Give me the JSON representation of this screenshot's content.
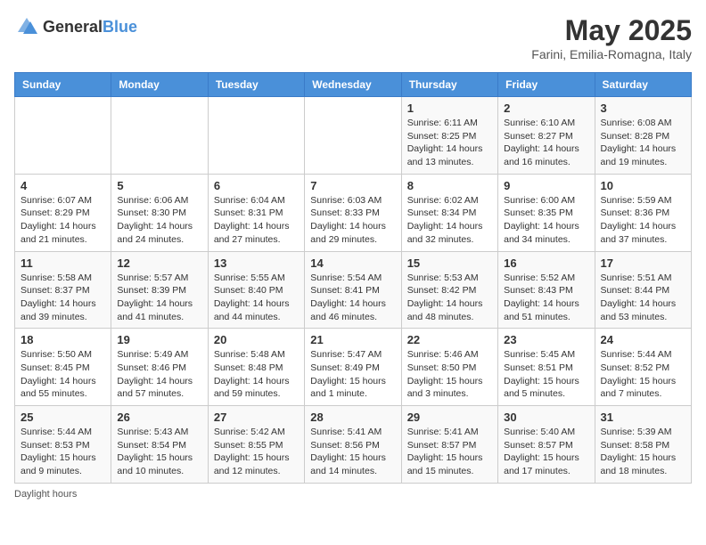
{
  "header": {
    "logo_general": "General",
    "logo_blue": "Blue",
    "month": "May 2025",
    "location": "Farini, Emilia-Romagna, Italy"
  },
  "weekdays": [
    "Sunday",
    "Monday",
    "Tuesday",
    "Wednesday",
    "Thursday",
    "Friday",
    "Saturday"
  ],
  "weeks": [
    [
      {
        "day": "",
        "info": ""
      },
      {
        "day": "",
        "info": ""
      },
      {
        "day": "",
        "info": ""
      },
      {
        "day": "",
        "info": ""
      },
      {
        "day": "1",
        "info": "Sunrise: 6:11 AM\nSunset: 8:25 PM\nDaylight: 14 hours and 13 minutes."
      },
      {
        "day": "2",
        "info": "Sunrise: 6:10 AM\nSunset: 8:27 PM\nDaylight: 14 hours and 16 minutes."
      },
      {
        "day": "3",
        "info": "Sunrise: 6:08 AM\nSunset: 8:28 PM\nDaylight: 14 hours and 19 minutes."
      }
    ],
    [
      {
        "day": "4",
        "info": "Sunrise: 6:07 AM\nSunset: 8:29 PM\nDaylight: 14 hours and 21 minutes."
      },
      {
        "day": "5",
        "info": "Sunrise: 6:06 AM\nSunset: 8:30 PM\nDaylight: 14 hours and 24 minutes."
      },
      {
        "day": "6",
        "info": "Sunrise: 6:04 AM\nSunset: 8:31 PM\nDaylight: 14 hours and 27 minutes."
      },
      {
        "day": "7",
        "info": "Sunrise: 6:03 AM\nSunset: 8:33 PM\nDaylight: 14 hours and 29 minutes."
      },
      {
        "day": "8",
        "info": "Sunrise: 6:02 AM\nSunset: 8:34 PM\nDaylight: 14 hours and 32 minutes."
      },
      {
        "day": "9",
        "info": "Sunrise: 6:00 AM\nSunset: 8:35 PM\nDaylight: 14 hours and 34 minutes."
      },
      {
        "day": "10",
        "info": "Sunrise: 5:59 AM\nSunset: 8:36 PM\nDaylight: 14 hours and 37 minutes."
      }
    ],
    [
      {
        "day": "11",
        "info": "Sunrise: 5:58 AM\nSunset: 8:37 PM\nDaylight: 14 hours and 39 minutes."
      },
      {
        "day": "12",
        "info": "Sunrise: 5:57 AM\nSunset: 8:39 PM\nDaylight: 14 hours and 41 minutes."
      },
      {
        "day": "13",
        "info": "Sunrise: 5:55 AM\nSunset: 8:40 PM\nDaylight: 14 hours and 44 minutes."
      },
      {
        "day": "14",
        "info": "Sunrise: 5:54 AM\nSunset: 8:41 PM\nDaylight: 14 hours and 46 minutes."
      },
      {
        "day": "15",
        "info": "Sunrise: 5:53 AM\nSunset: 8:42 PM\nDaylight: 14 hours and 48 minutes."
      },
      {
        "day": "16",
        "info": "Sunrise: 5:52 AM\nSunset: 8:43 PM\nDaylight: 14 hours and 51 minutes."
      },
      {
        "day": "17",
        "info": "Sunrise: 5:51 AM\nSunset: 8:44 PM\nDaylight: 14 hours and 53 minutes."
      }
    ],
    [
      {
        "day": "18",
        "info": "Sunrise: 5:50 AM\nSunset: 8:45 PM\nDaylight: 14 hours and 55 minutes."
      },
      {
        "day": "19",
        "info": "Sunrise: 5:49 AM\nSunset: 8:46 PM\nDaylight: 14 hours and 57 minutes."
      },
      {
        "day": "20",
        "info": "Sunrise: 5:48 AM\nSunset: 8:48 PM\nDaylight: 14 hours and 59 minutes."
      },
      {
        "day": "21",
        "info": "Sunrise: 5:47 AM\nSunset: 8:49 PM\nDaylight: 15 hours and 1 minute."
      },
      {
        "day": "22",
        "info": "Sunrise: 5:46 AM\nSunset: 8:50 PM\nDaylight: 15 hours and 3 minutes."
      },
      {
        "day": "23",
        "info": "Sunrise: 5:45 AM\nSunset: 8:51 PM\nDaylight: 15 hours and 5 minutes."
      },
      {
        "day": "24",
        "info": "Sunrise: 5:44 AM\nSunset: 8:52 PM\nDaylight: 15 hours and 7 minutes."
      }
    ],
    [
      {
        "day": "25",
        "info": "Sunrise: 5:44 AM\nSunset: 8:53 PM\nDaylight: 15 hours and 9 minutes."
      },
      {
        "day": "26",
        "info": "Sunrise: 5:43 AM\nSunset: 8:54 PM\nDaylight: 15 hours and 10 minutes."
      },
      {
        "day": "27",
        "info": "Sunrise: 5:42 AM\nSunset: 8:55 PM\nDaylight: 15 hours and 12 minutes."
      },
      {
        "day": "28",
        "info": "Sunrise: 5:41 AM\nSunset: 8:56 PM\nDaylight: 15 hours and 14 minutes."
      },
      {
        "day": "29",
        "info": "Sunrise: 5:41 AM\nSunset: 8:57 PM\nDaylight: 15 hours and 15 minutes."
      },
      {
        "day": "30",
        "info": "Sunrise: 5:40 AM\nSunset: 8:57 PM\nDaylight: 15 hours and 17 minutes."
      },
      {
        "day": "31",
        "info": "Sunrise: 5:39 AM\nSunset: 8:58 PM\nDaylight: 15 hours and 18 minutes."
      }
    ]
  ],
  "footer": {
    "note": "Daylight hours"
  }
}
